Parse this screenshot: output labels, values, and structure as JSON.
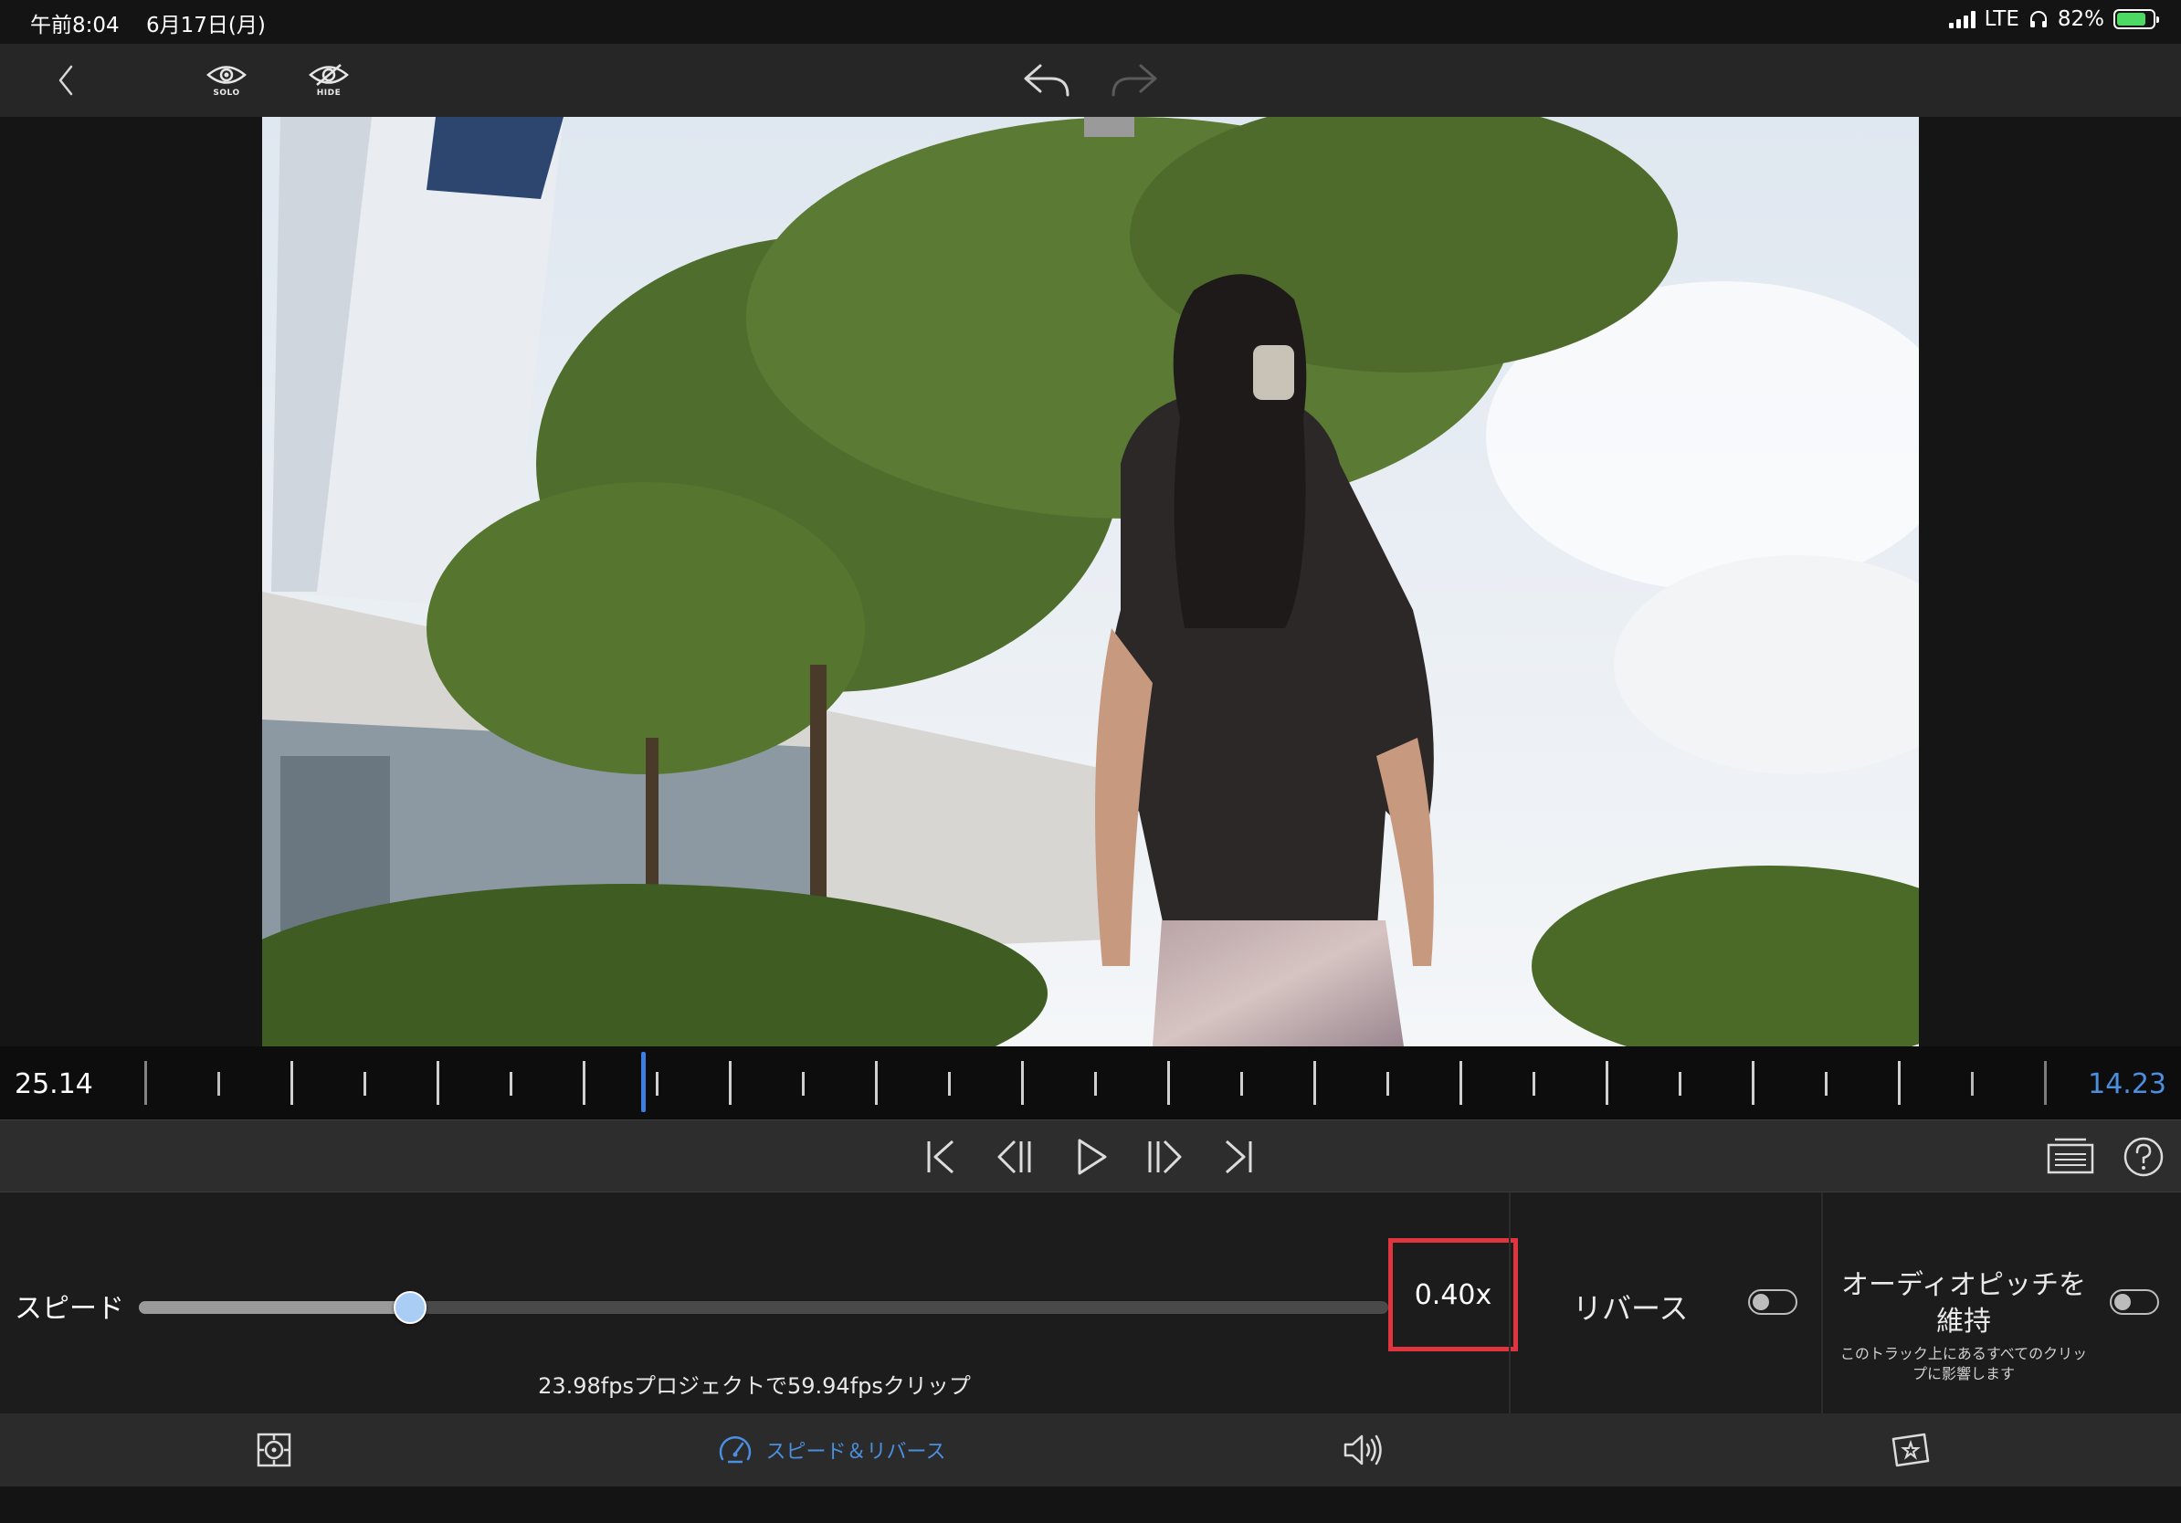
{
  "status_bar": {
    "time": "午前8:04",
    "date": "6月17日(月)",
    "network": "LTE",
    "battery": "82%",
    "battery_level": 0.82,
    "battery_color": "#4cd964"
  },
  "toolbar": {
    "solo_caption": "SOLO",
    "hide_caption": "HIDE",
    "icons": [
      "back-chevron-icon",
      "eye-icon",
      "eye-slash-icon",
      "undo-icon",
      "redo-icon"
    ]
  },
  "timeline": {
    "current_time": "25.14",
    "end_time": "14.23",
    "accent_color": "#4a8fe0"
  },
  "transport": {
    "icons": [
      "skip-to-start-icon",
      "step-back-icon",
      "play-icon",
      "step-forward-icon",
      "skip-to-end-icon",
      "clip-info-icon",
      "help-icon"
    ]
  },
  "speed_panel": {
    "speed_label": "スピード",
    "speed_value": "0.40x",
    "slider_position": 0.217,
    "fps_info": "23.98fpsプロジェクトで59.94fpsクリップ",
    "reverse_label": "リバース",
    "reverse_enabled": false,
    "pitch_label_line1": "オーディオピッチを",
    "pitch_label_line2": "維持",
    "pitch_note_line1": "このトラック上にあるすべてのクリッ",
    "pitch_note_line2": "プに影響します",
    "pitch_enabled": false,
    "highlight_color": "#e0353f"
  },
  "tabs": {
    "active_label": "スピード＆リバース",
    "icons": [
      "transform-icon",
      "speedometer-icon",
      "speaker-icon",
      "effects-icon"
    ]
  }
}
